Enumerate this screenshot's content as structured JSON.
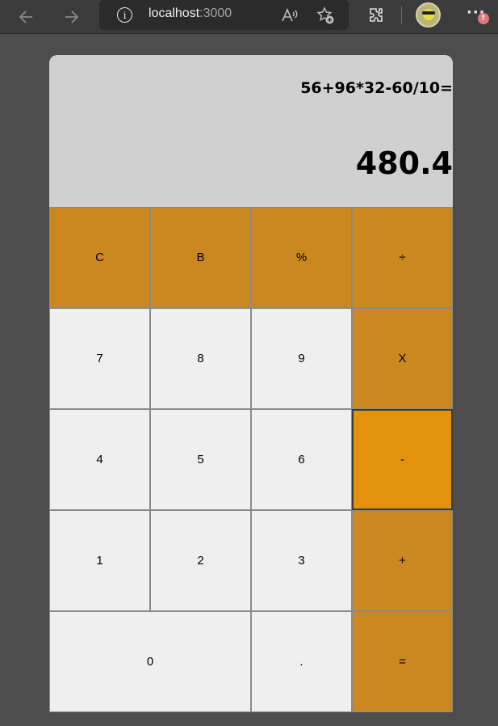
{
  "browser": {
    "host": "localhost",
    "port": ":3000",
    "info_glyph": "i",
    "more_glyph": "···",
    "badge_glyph": "↑"
  },
  "calculator": {
    "expression": "56+96*32-60/10=",
    "result": "480.4",
    "keys": {
      "clear": "C",
      "back": "B",
      "percent": "%",
      "divide": "÷",
      "seven": "7",
      "eight": "8",
      "nine": "9",
      "multiply": "X",
      "four": "4",
      "five": "5",
      "six": "6",
      "subtract": "-",
      "one": "1",
      "two": "2",
      "three": "3",
      "add": "+",
      "zero": "0",
      "decimal": ".",
      "equals": "="
    }
  },
  "colors": {
    "operator_key": "#cc8820",
    "active_key": "#e3920e",
    "number_key": "#efefef",
    "display_bg": "#d0d0d0",
    "page_bg": "#4d4d4d"
  }
}
